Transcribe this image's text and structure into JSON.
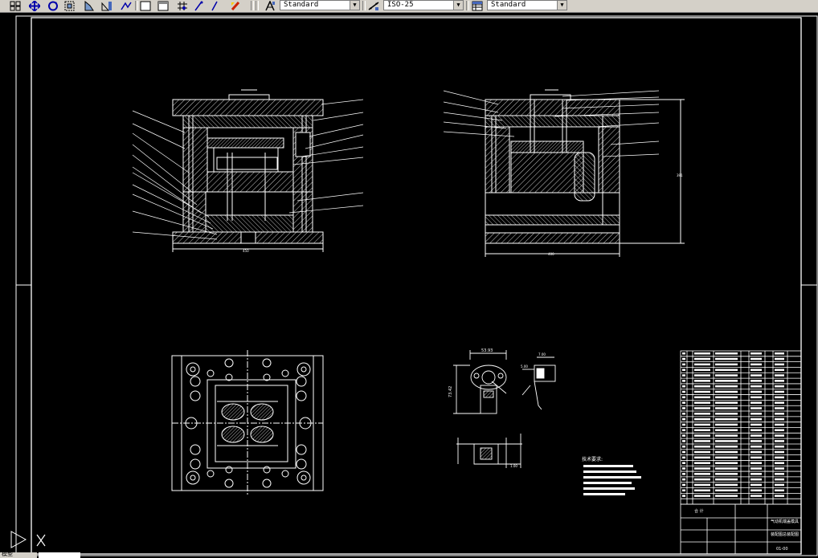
{
  "toolbar": {
    "text_style": "Standard",
    "dim_style": "ISO-25",
    "table_style": "Standard",
    "icons": [
      "select-window-icon",
      "pan-icon",
      "orbit-icon",
      "zoom-window-icon",
      "zoom-previous-icon",
      "measure-icon",
      "polyline-icon",
      "rectangle-icon",
      "rectangle-alt-icon",
      "snap-icon",
      "line-icon",
      "properties-icon",
      "text-style-icon",
      "dim-style-icon",
      "table-style-icon"
    ]
  },
  "drawing": {
    "dim_front_width": "450",
    "dim_side_width": "400",
    "dim_side_height": "391",
    "dim_part_width": "53.93",
    "dim_part_height": "73.42",
    "dim_part_side": "5.00",
    "dim_part_side2": "7.00",
    "dim_section": "1.00",
    "tech_req_title": "技术要求:",
    "title_block_name": "气动机端盖模具",
    "title_block_sub": "装配图总装配图",
    "title_block_code": "01-00",
    "title_block_row": "合 计"
  },
  "colors": {
    "background": "#000000",
    "lines": "#ffffff",
    "toolbar": "#d4d0c8"
  },
  "status": {
    "model_tab": "模型"
  }
}
